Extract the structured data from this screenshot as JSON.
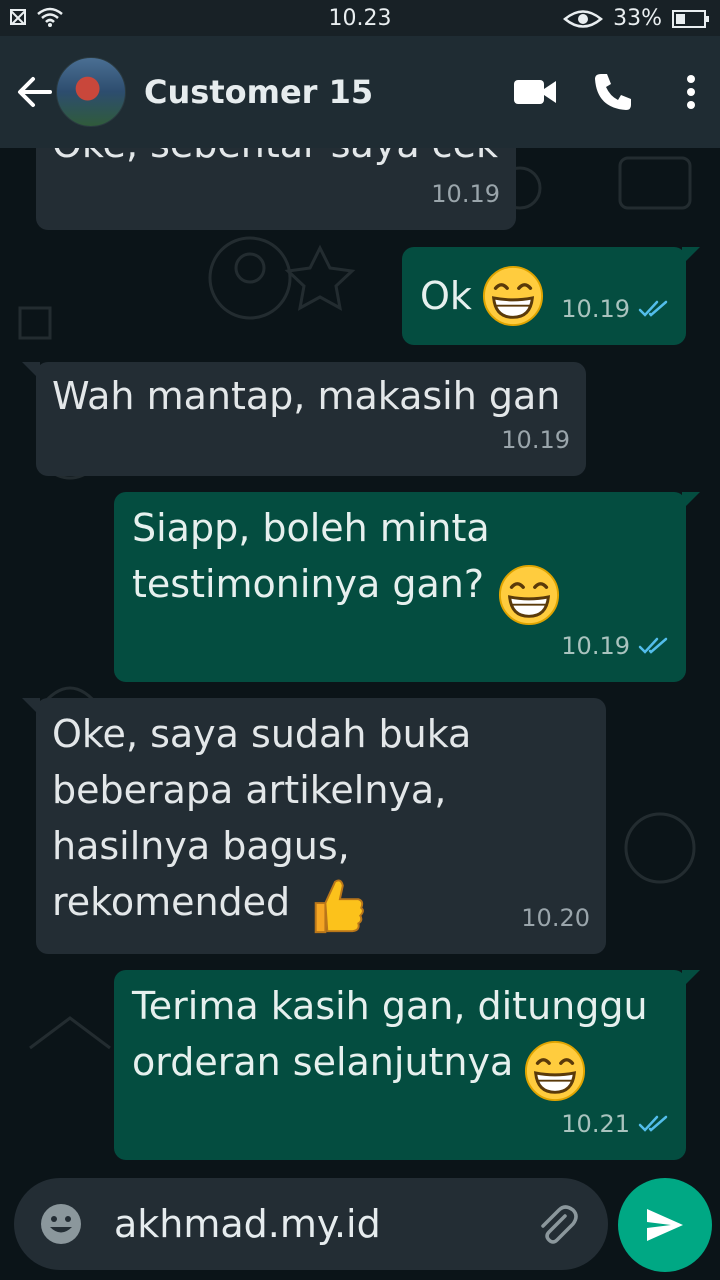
{
  "status": {
    "time": "10.23",
    "battery": "33%",
    "battery_level": 0.33
  },
  "header": {
    "contact_name": "Customer 15"
  },
  "messages": [
    {
      "direction": "in",
      "text": "Oke, sebentar saya cek",
      "time": "10.19"
    },
    {
      "direction": "out",
      "text": "Ok",
      "emoji": "grinning-face",
      "time": "10.19",
      "read": true
    },
    {
      "direction": "in",
      "text": "Wah mantap, makasih gan",
      "time": "10.19"
    },
    {
      "direction": "out",
      "text": "Siapp, boleh minta\ntestimoninya gan?",
      "emoji": "grinning-face",
      "time": "10.19",
      "read": true
    },
    {
      "direction": "in",
      "text": "Oke, saya sudah buka\nbeberapa artikelnya,\nhasilnya bagus,\nrekomended",
      "emoji": "thumbs-up",
      "time": "10.20"
    },
    {
      "direction": "out",
      "text": "Terima kasih gan, ditunggu\norderan selanjutnya",
      "emoji": "grinning-face",
      "time": "10.21",
      "read": true
    }
  ],
  "composer": {
    "value": "akhmad.my.id"
  },
  "colors": {
    "incoming": "#232d34",
    "outgoing": "#044d40",
    "send_button": "#00a884",
    "read_ticks": "#53bdeb"
  }
}
